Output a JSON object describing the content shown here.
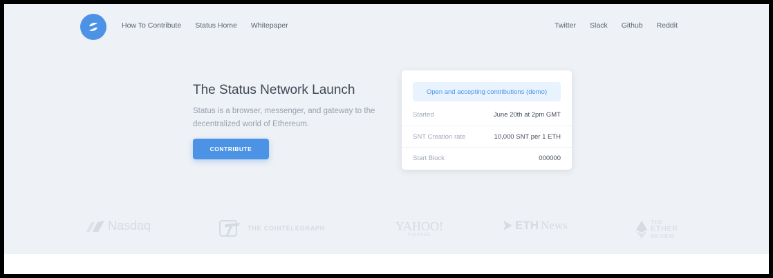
{
  "nav": {
    "left": [
      "How To Contribute",
      "Status Home",
      "Whitepaper"
    ],
    "right": [
      "Twitter",
      "Slack",
      "Github",
      "Reddit"
    ]
  },
  "hero": {
    "title": "The Status Network Launch",
    "subtitle": "Status is a browser, messenger, and gateway to the decentralized world of Ethereum.",
    "cta": "CONTRIBUTE"
  },
  "card": {
    "status": "Open and accepting contributions (demo)",
    "rows": [
      {
        "label": "Started",
        "value": "June 20th at 2pm GMT"
      },
      {
        "label": "SNT Creation rate",
        "value": "10,000 SNT per 1 ETH"
      },
      {
        "label": "Start Block",
        "value": "000000"
      }
    ]
  },
  "press": {
    "nasdaq": "Nasdaq",
    "cointelegraph": "THE COINTELEGRAPH",
    "yahoo_main": "YAHOO!",
    "yahoo_sub": "FINANCE",
    "ethnews_eth": "ETH",
    "ethnews_news": "News",
    "ether_review": [
      "THE",
      "ETHER",
      "REVIEW"
    ]
  },
  "colors": {
    "accent": "#4c93e6",
    "background": "#eef1f5",
    "badge_bg": "#e9f3fd"
  }
}
